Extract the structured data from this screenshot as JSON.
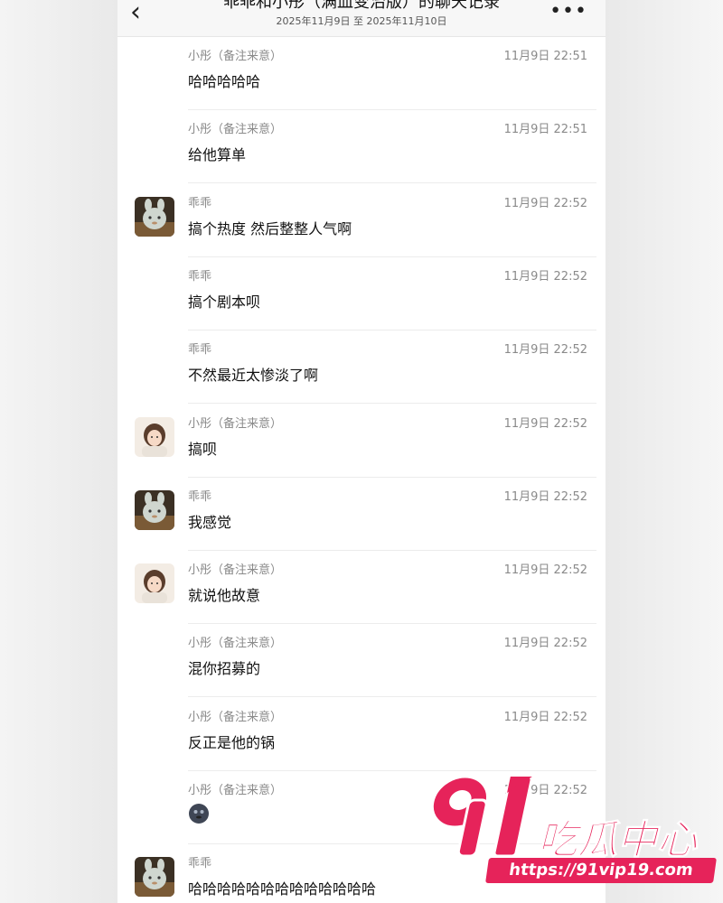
{
  "header": {
    "title": "乖乖和小彤（满血变治版）的聊天记录",
    "subtitle": "2025年11月9日 至 2025年11月10日"
  },
  "messages": [
    {
      "sender": "小彤（备注来意）",
      "time": "11月9日 22:51",
      "text": "哈哈哈哈哈",
      "avatar": "none"
    },
    {
      "sender": "小彤（备注来意）",
      "time": "11月9日 22:51",
      "text": "给他算单",
      "avatar": "none"
    },
    {
      "sender": "乖乖",
      "time": "11月9日 22:52",
      "text": "搞个热度 然后整整人气啊",
      "avatar": "guaiguai"
    },
    {
      "sender": "乖乖",
      "time": "11月9日 22:52",
      "text": "搞个剧本呗",
      "avatar": "none"
    },
    {
      "sender": "乖乖",
      "time": "11月9日 22:52",
      "text": "不然最近太惨淡了啊",
      "avatar": "none"
    },
    {
      "sender": "小彤（备注来意）",
      "time": "11月9日 22:52",
      "text": "搞呗",
      "avatar": "xiaotong"
    },
    {
      "sender": "乖乖",
      "time": "11月9日 22:52",
      "text": "我感觉",
      "avatar": "guaiguai"
    },
    {
      "sender": "小彤（备注来意）",
      "time": "11月9日 22:52",
      "text": "就说他故意",
      "avatar": "xiaotong"
    },
    {
      "sender": "小彤（备注来意）",
      "time": "11月9日 22:52",
      "text": "混你招募的",
      "avatar": "none"
    },
    {
      "sender": "小彤（备注来意）",
      "time": "11月9日 22:52",
      "text": "反正是他的锅",
      "avatar": "none"
    },
    {
      "sender": "小彤（备注来意）",
      "time": "11月9日 22:52",
      "text": "",
      "avatar": "none",
      "sticker": "round-face-emoji-icon"
    },
    {
      "sender": "乖乖",
      "time": "",
      "text": "哈哈哈哈哈哈哈哈哈哈哈哈哈",
      "avatar": "guaiguai"
    }
  ],
  "watermark": {
    "number": "91",
    "name": "吃瓜中心",
    "url": "https://91vip19.com",
    "color": "#e6235a"
  },
  "icons": {
    "back": "chevron-left-icon",
    "more": "more-dots-icon"
  }
}
